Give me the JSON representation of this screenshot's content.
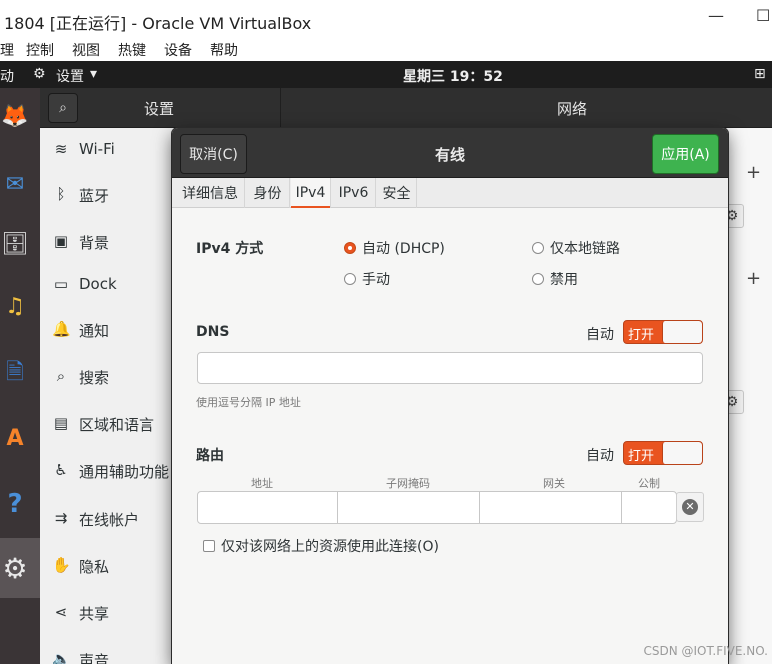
{
  "host_window": {
    "title": "1804 [正在运行] - Oracle VM VirtualBox",
    "minimize_glyph": "—",
    "maximize_glyph": "☐",
    "menu": [
      "理",
      "控制",
      "视图",
      "热键",
      "设备",
      "帮助"
    ]
  },
  "top_panel": {
    "activities": "动",
    "app_menu_label": "设置",
    "app_menu_arrow": "▾",
    "app_menu_icon": "gear-icon",
    "clock": "星期三 19：52",
    "network_icon": "network-icon",
    "network_glyph": "⊞"
  },
  "dock": [
    {
      "name": "firefox-icon",
      "glyph": "🦊"
    },
    {
      "name": "thunderbird-icon",
      "glyph": "✉"
    },
    {
      "name": "files-icon",
      "glyph": "🗄"
    },
    {
      "name": "rhythmbox-icon",
      "glyph": "♫"
    },
    {
      "name": "writer-icon",
      "glyph": "🗎"
    },
    {
      "name": "software-icon",
      "glyph": "A"
    },
    {
      "name": "help-icon",
      "glyph": "?"
    },
    {
      "name": "settings-app-icon",
      "glyph": "⚙"
    }
  ],
  "settings": {
    "header_left": "设置",
    "header_right": "网络",
    "search_glyph": "⌕",
    "sidebar": [
      {
        "label": "Wi-Fi",
        "icon": "wifi-icon",
        "glyph": "≋"
      },
      {
        "label": "蓝牙",
        "icon": "bluetooth-icon",
        "glyph": "ᛒ"
      },
      {
        "label": "背景",
        "icon": "background-icon",
        "glyph": "▣"
      },
      {
        "label": "Dock",
        "icon": "dock-icon",
        "glyph": "▭"
      },
      {
        "label": "通知",
        "icon": "bell-icon",
        "glyph": "🔔"
      },
      {
        "label": "搜索",
        "icon": "search-icon",
        "glyph": "⌕"
      },
      {
        "label": "区域和语言",
        "icon": "region-icon",
        "glyph": "▤"
      },
      {
        "label": "通用辅助功能",
        "icon": "accessibility-icon",
        "glyph": "♿"
      },
      {
        "label": "在线帐户",
        "icon": "online-accounts-icon",
        "glyph": "⇉"
      },
      {
        "label": "隐私",
        "icon": "hand-icon",
        "glyph": "✋"
      },
      {
        "label": "共享",
        "icon": "share-icon",
        "glyph": "⋖"
      },
      {
        "label": "声音",
        "icon": "speaker-icon",
        "glyph": "🔈"
      }
    ],
    "net_plus_glyph": "+",
    "net_gear_glyph": "⚙"
  },
  "dialog": {
    "cancel": "取消(C)",
    "title": "有线",
    "apply": "应用(A)",
    "tabs": [
      "详细信息",
      "身份",
      "IPv4",
      "IPv6",
      "安全"
    ],
    "ipv4_method_label": "IPv4 方式",
    "methods": {
      "auto_dhcp": "自动 (DHCP)",
      "link_local": "仅本地链路",
      "manual": "手动",
      "disabled": "禁用",
      "selected": "auto_dhcp"
    },
    "dns": {
      "label": "DNS",
      "auto_label": "自动",
      "switch_text": "打开",
      "switch_on": true,
      "value": "",
      "hint": "使用逗号分隔 IP 地址"
    },
    "routes": {
      "label": "路由",
      "auto_label": "自动",
      "switch_text": "打开",
      "switch_on": true,
      "columns": [
        "地址",
        "子网掩码",
        "网关",
        "公制"
      ],
      "clear_glyph": "✕"
    },
    "only_local_checkbox": "仅对该网络上的资源使用此连接(O)",
    "only_local_checked": false
  },
  "colors": {
    "accent": "#e95420",
    "apply_green": "#3eb34f"
  },
  "watermark": "CSDN @IOT.FIVE.NO."
}
